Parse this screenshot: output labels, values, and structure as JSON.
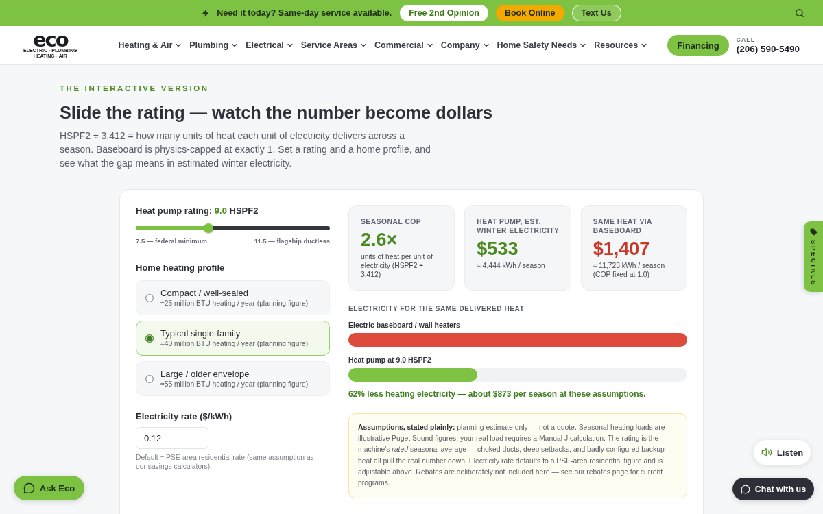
{
  "announcement": {
    "text": "Need it today? Same-day service available.",
    "buttons": [
      {
        "label": "Free 2nd Opinion",
        "kind": "light"
      },
      {
        "label": "Book Online",
        "kind": "accent"
      },
      {
        "label": "Text Us",
        "kind": "outline"
      }
    ]
  },
  "header": {
    "logo": {
      "wordmark": "eco",
      "tagline": [
        "ELECTRIC · PLUMBING",
        "HEATING · AIR"
      ]
    },
    "nav": [
      "Heating & Air",
      "Plumbing",
      "Electrical",
      "Service Areas",
      "Commercial",
      "Company",
      "Home Safety Needs",
      "Resources"
    ],
    "cta": "Financing",
    "call_label": "CALL",
    "phone": "(206) 590-5490"
  },
  "intro": {
    "eyebrow": "THE INTERACTIVE VERSION",
    "title": "Slide the rating — watch the number become dollars",
    "body": "HSPF2 ÷ 3.412 = how many units of heat each unit of electricity delivers across a season. Baseboard is physics-capped at exactly 1. Set a rating and a home profile, and see what the gap means in estimated winter electricity."
  },
  "calculator": {
    "rating": {
      "label": "Heat pump rating:",
      "value": "9.0",
      "unit": "HSPF2",
      "level": 0.375,
      "min_label": "7.5 — federal minimum",
      "max_label": "11.5 — flagship ductless"
    },
    "profile": {
      "heading": "Home heating profile",
      "options": [
        {
          "title": "Compact / well-sealed",
          "detail": "≈25 million BTU heating / year (planning figure)",
          "selected": false
        },
        {
          "title": "Typical single-family",
          "detail": "≈40 million BTU heating / year (planning figure)",
          "selected": true
        },
        {
          "title": "Large / older envelope",
          "detail": "≈55 million BTU heating / year (planning figure)",
          "selected": false
        }
      ]
    },
    "rate": {
      "label": "Electricity rate ($/kWh)",
      "value": "0.12",
      "help": "Default ≈ PSE-area residential rate (same assumption as our savings calculators)."
    },
    "stats": [
      {
        "label": "SEASONAL COP",
        "value": "2.6×",
        "note": "units of heat per unit of electricity (HSPF2 ÷ 3.412)",
        "kind": "positive"
      },
      {
        "label": "HEAT PUMP, EST. WINTER ELECTRICITY",
        "value": "$533",
        "note": "≈ 4,444 kWh / season",
        "kind": "positive"
      },
      {
        "label": "SAME HEAT VIA BASEBOARD",
        "value": "$1,407",
        "note": "≈ 11,723 kWh / season (COP fixed at 1.0)",
        "kind": "negative"
      }
    ],
    "comparison": {
      "heading": "ELECTRICITY FOR THE SAME DELIVERED HEAT",
      "bars": [
        {
          "label": "Electric baseboard / wall heaters",
          "level": 1.0,
          "color": "#de4a3b"
        },
        {
          "label": "Heat pump at 9.0 HSPF2",
          "level": 0.38,
          "color": "#7dc242"
        }
      ],
      "summary": "62% less heating electricity — about $873 per season at these assumptions."
    },
    "assumptions": "**Assumptions, stated plainly:** planning estimate only — not a quote. Seasonal heating loads are illustrative Puget Sound figures; your real load requires a Manual J calculation. The rating is the machine's *rated* seasonal average — choked ducts, deep setbacks, and badly configured backup heat all pull the real number down. Electricity rate defaults to a PSE-area residential figure and is adjustable above. Rebates are deliberately not included here — see our rebates page for current programs."
  },
  "floating": {
    "specials": "SPECIALS",
    "listen": "Listen",
    "chat": "Chat with us",
    "ask": "Ask Eco"
  }
}
